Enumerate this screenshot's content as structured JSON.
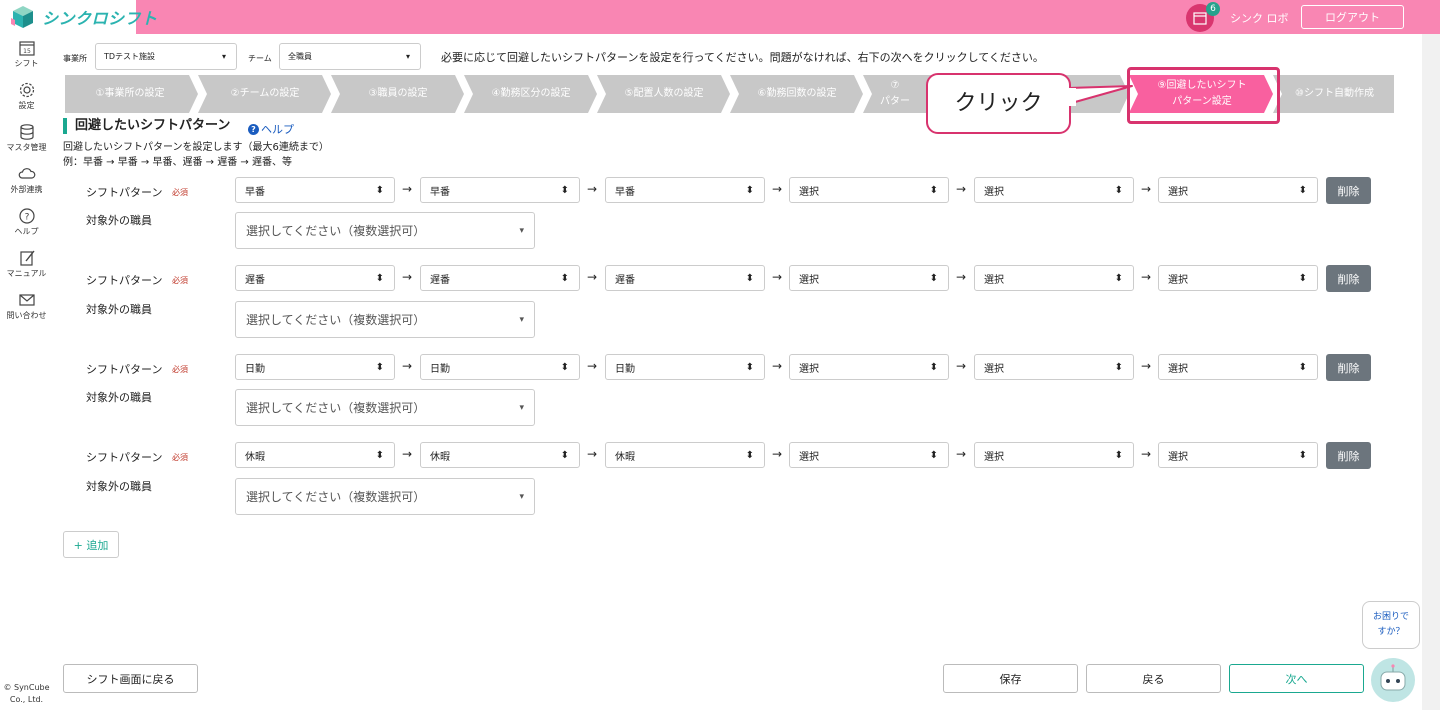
{
  "app": {
    "logo_text": "シンクロシフト",
    "user_name": "シンク ロボ",
    "logout_label": "ログアウト",
    "calendar_day": "15",
    "notification_count": "6"
  },
  "sidebar": {
    "items": [
      {
        "label": "シフト",
        "icon": "calendar-icon"
      },
      {
        "label": "設定",
        "icon": "gear-icon"
      },
      {
        "label": "マスタ管理",
        "icon": "database-icon"
      },
      {
        "label": "外部連携",
        "icon": "cloud-sync-icon"
      },
      {
        "label": "ヘルプ",
        "icon": "help-icon"
      },
      {
        "label": "マニュアル",
        "icon": "manual-icon"
      },
      {
        "label": "問い合わせ",
        "icon": "mail-icon"
      }
    ],
    "copyright_line1": "© SynCube",
    "copyright_line2": "Co., Ltd."
  },
  "filters": {
    "office_label": "事業所",
    "office_value": "TDテスト施設",
    "team_label": "チーム",
    "team_value": "全職員"
  },
  "instruction": "必要に応じて回避したいシフトパターンを設定を行ってください。問題がなければ、右下の次へをクリックしてください。",
  "steps": [
    {
      "label": "①事業所の設定"
    },
    {
      "label": "②チームの設定"
    },
    {
      "label": "③職員の設定"
    },
    {
      "label": "④勤務区分の設定"
    },
    {
      "label": "⑤配置人数の設定"
    },
    {
      "label": "⑥勤務回数の設定"
    },
    {
      "label": "⑦",
      "label2": "パター"
    },
    {
      "label": "⑧"
    },
    {
      "label": "⑨回避したいシフト",
      "label2": "パターン設定"
    },
    {
      "label": "⑩シフト自動作成"
    }
  ],
  "section": {
    "title": "回避したいシフトパターン",
    "help_label": "ヘルプ",
    "desc1": "回避したいシフトパターンを設定します（最大6連続まで）",
    "desc2": "例：早番 → 早番 → 早番、遅番 → 遅番 → 遅番、等"
  },
  "labels": {
    "pattern": "シフトパターン",
    "required": "必須",
    "excluded": "対象外の職員",
    "multi_placeholder": "選択してください（複数選択可）",
    "delete": "削除",
    "arrow": "→"
  },
  "patterns": [
    {
      "shifts": [
        "早番",
        "早番",
        "早番",
        "選択",
        "選択",
        "選択"
      ]
    },
    {
      "shifts": [
        "遅番",
        "遅番",
        "遅番",
        "選択",
        "選択",
        "選択"
      ]
    },
    {
      "shifts": [
        "日勤",
        "日勤",
        "日勤",
        "選択",
        "選択",
        "選択"
      ]
    },
    {
      "shifts": [
        "休暇",
        "休暇",
        "休暇",
        "選択",
        "選択",
        "選択"
      ]
    }
  ],
  "buttons": {
    "add": "+ 追加",
    "back_to_shift": "シフト画面に戻る",
    "save": "保存",
    "back": "戻る",
    "next": "次へ"
  },
  "annotation": {
    "callout": "クリック"
  },
  "chat": {
    "line1": "お困りで",
    "line2": "すか？"
  },
  "colors": {
    "accent": "#1aa890",
    "header": "#f986b3",
    "step": "#c8c8c8",
    "active_step": "#f9609f",
    "highlight": "#d8336e"
  }
}
